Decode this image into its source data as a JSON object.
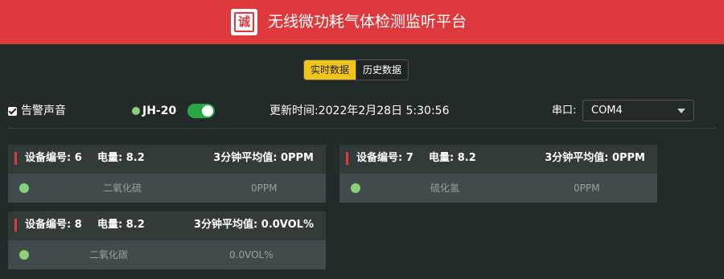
{
  "app": {
    "logo_char": "诚",
    "title": "无线微功耗气体检测监听平台"
  },
  "tabs": [
    {
      "label": "实时数据",
      "active": true
    },
    {
      "label": "历史数据",
      "active": false
    }
  ],
  "toolbar": {
    "alarm_sound": {
      "label": "告警声音",
      "checked": true
    },
    "device": {
      "id": "JH-20",
      "status": "online",
      "enabled": true
    },
    "update_time": "更新时间:2022年2月28日 5:30:56",
    "port": {
      "label": "串口:",
      "value": "COM4"
    }
  },
  "cards": [
    {
      "device_no": "设备编号: 6",
      "battery": "电量: 8.2",
      "avg3": "3分钟平均值: 0PPM",
      "gas": "二氧化硫",
      "value": "0PPM"
    },
    {
      "device_no": "设备编号: 7",
      "battery": "电量: 8.2",
      "avg3": "3分钟平均值: 0PPM",
      "gas": "硫化氢",
      "value": "0PPM"
    },
    {
      "device_no": "设备编号: 8",
      "battery": "电量: 8.2",
      "avg3": "3分钟平均值: 0.0VOL%",
      "gas": "二氧化碳",
      "value": "0.0VOL%"
    }
  ],
  "colors": {
    "header": "#de3a3e",
    "active_tab": "#f2c318",
    "background": "#232a2a",
    "status_ok": "#8ad27a",
    "toggle_on": "#28a745"
  }
}
